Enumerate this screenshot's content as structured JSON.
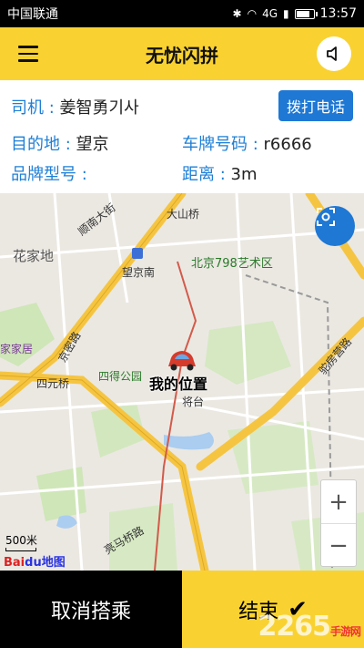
{
  "status_bar": {
    "carrier": "中国联通",
    "network": "4G",
    "time": "13:57",
    "battery_level": 0.8
  },
  "header": {
    "title": "无忧闪拼",
    "menu_icon": "hamburger-menu-icon",
    "speaker_icon": "speaker-icon"
  },
  "info": {
    "driver_label": "司机 : ",
    "driver_value": "姜智勇기사",
    "call_button": "拨打电话",
    "destination_label": "目的地 : ",
    "destination_value": "望京",
    "plate_label": "车牌号码 : ",
    "plate_value": "r6666",
    "brand_label": "品牌型号 : ",
    "brand_value": "",
    "distance_label": "距离 : ",
    "distance_value": "3m",
    "label_color": "#1e7fd6"
  },
  "map": {
    "labels": {
      "dashanzi": "大山桥",
      "huajiadi": "花家地",
      "wangjingnan": "望京南",
      "beijing798": "北京798艺术区",
      "jiaju": "家家居",
      "siyuanqiao": "四元桥",
      "sidegongyuan": "四得公园",
      "jiangtai": "将台",
      "jingmi": "京密路",
      "tuofang": "驼房营路",
      "liangmaqiao": "亮马桥路",
      "hudong": "顺南大街"
    },
    "my_position": "我的位置",
    "scale": "500米",
    "logo_red": "Bai",
    "logo_blue": "du地图",
    "zoom_in": "+",
    "zoom_out": "−",
    "locate_icon": "locate-scan-icon",
    "car_icon": "car-icon"
  },
  "bottom": {
    "cancel": "取消搭乘",
    "end": "结束",
    "end_icon": "checkmark-icon"
  },
  "watermark": {
    "text": "2265",
    "suffix": "手游网"
  },
  "colors": {
    "brand_yellow": "#f9d231",
    "primary_blue": "#1e78d4"
  }
}
